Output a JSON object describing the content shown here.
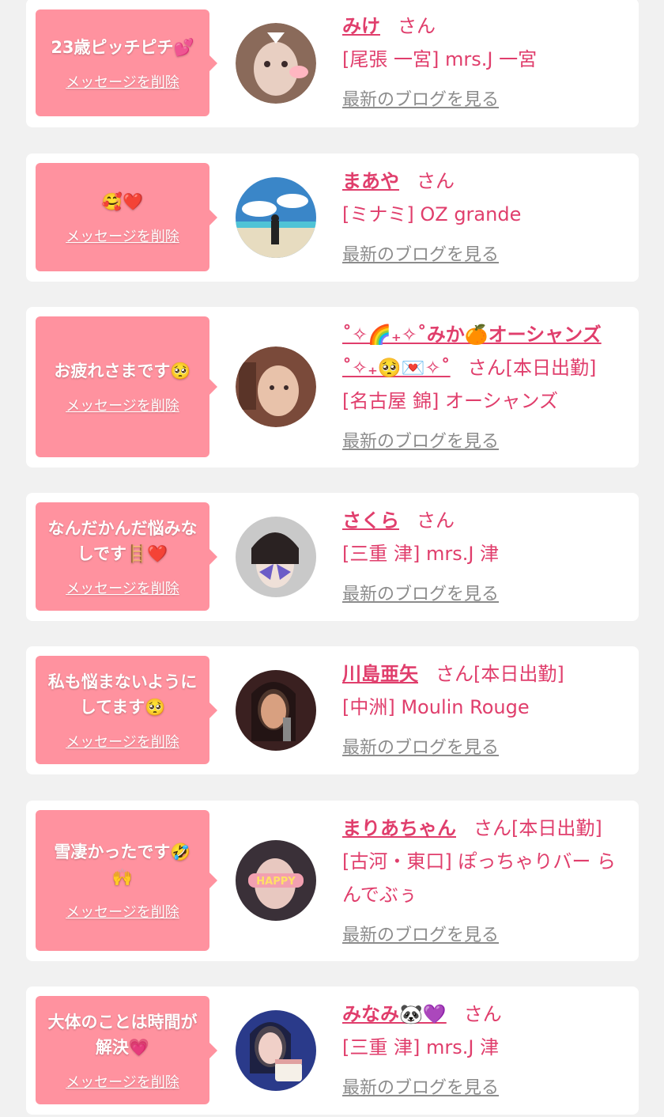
{
  "items": [
    {
      "message": "23歳ピッチピチ💕",
      "delete_label": "メッセージを削除",
      "name": "みけ",
      "honorific": "さん",
      "shop": "[尾張 一宮] mrs.J 一宮",
      "blog_link": "最新のブログを見る",
      "avatar_colors": [
        "#8a6a5a",
        "#e8cfc2"
      ]
    },
    {
      "message": "🥰❤️",
      "delete_label": "メッセージを削除",
      "name": "まあや",
      "honorific": "さん",
      "shop": "[ミナミ] OZ grande",
      "blog_link": "最新のブログを見る",
      "avatar_colors": [
        "#3a86c8",
        "#e7dcc0"
      ]
    },
    {
      "message": "お疲れさまです🥺",
      "delete_label": "メッセージを削除",
      "name": "˚✧🌈₊✧˚みか🍊オーシャンズ˚✧₊🥺💌✧˚",
      "honorific": "さん[本日出勤]",
      "shop": "[名古屋 錦] オーシャンズ",
      "blog_link": "最新のブログを見る",
      "avatar_colors": [
        "#7a4a3a",
        "#e8c2aa"
      ]
    },
    {
      "message": "なんだかんだ悩みなしです🪜❤️",
      "delete_label": "メッセージを削除",
      "name": "さくら",
      "honorific": "さん",
      "shop": "[三重 津] mrs.J 津",
      "blog_link": "最新のブログを見る",
      "avatar_colors": [
        "#c9c9c9",
        "#6b5cc7"
      ]
    },
    {
      "message": "私も悩まないようにしてます🥺",
      "delete_label": "メッセージを削除",
      "name": "川島亜矢",
      "honorific": "さん[本日出勤]",
      "shop": "[中洲] Moulin Rouge",
      "blog_link": "最新のブログを見る",
      "avatar_colors": [
        "#3a2020",
        "#c89070"
      ]
    },
    {
      "message": "雪凄かったです🤣🙌",
      "delete_label": "メッセージを削除",
      "name": "まりあちゃん",
      "honorific": "さん[本日出勤]",
      "shop": "[古河・東口] ぽっちゃりバー らんでぶぅ",
      "blog_link": "最新のブログを見る",
      "avatar_colors": [
        "#3a3038",
        "#f2a0b0"
      ]
    },
    {
      "message": "大体のことは時間が解決💗",
      "delete_label": "メッセージを削除",
      "name": "みなみ🐼💜",
      "honorific": "さん",
      "shop": "[三重 津] mrs.J 津",
      "blog_link": "最新のブログを見る",
      "avatar_colors": [
        "#2a3a8a",
        "#e0a0a0"
      ]
    }
  ]
}
